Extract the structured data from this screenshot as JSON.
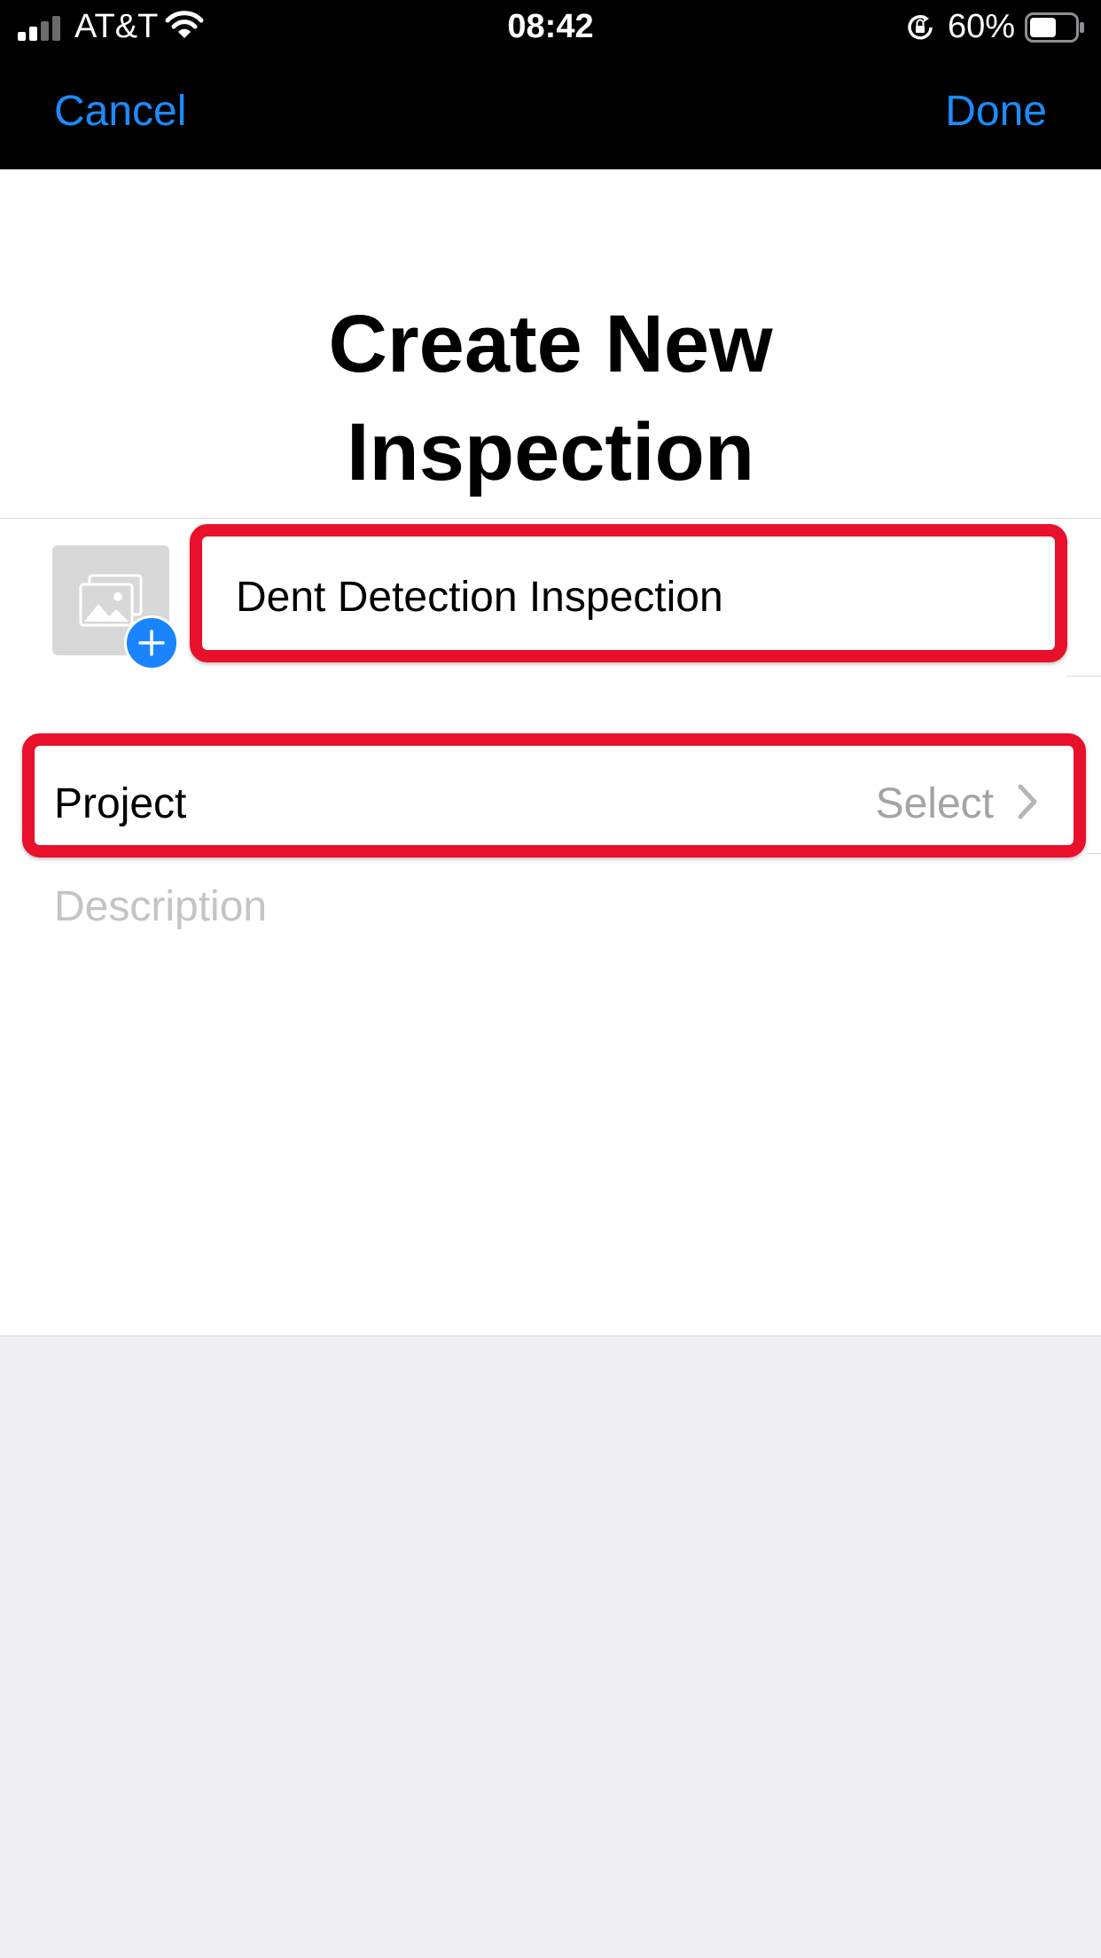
{
  "status_bar": {
    "carrier": "AT&T",
    "time": "08:42",
    "battery_percent": "60%",
    "battery_level": 0.6
  },
  "nav": {
    "cancel_label": "Cancel",
    "done_label": "Done"
  },
  "page": {
    "title_line1": "Create New",
    "title_line2": "Inspection"
  },
  "form": {
    "name_value": "Dent Detection Inspection",
    "project_label": "Project",
    "project_value": "Select",
    "description_placeholder": "Description"
  },
  "colors": {
    "accent": "#1a8cff",
    "highlight": "#e8102a",
    "placeholder": "#c4c4c7"
  }
}
